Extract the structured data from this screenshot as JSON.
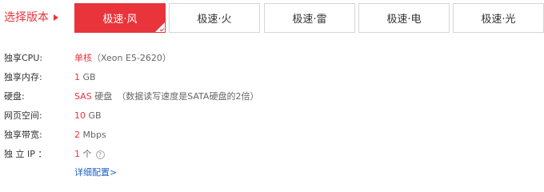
{
  "select": {
    "label": "选择版本"
  },
  "plans": [
    {
      "label": "极速·风",
      "active": true
    },
    {
      "label": "极速·火",
      "active": false
    },
    {
      "label": "极速·雷",
      "active": false
    },
    {
      "label": "极速·电",
      "active": false
    },
    {
      "label": "极速·光",
      "active": false
    }
  ],
  "specs": {
    "cpu": {
      "label": "独享CPU:",
      "value": "单核",
      "detail": "（Xeon E5-2620）"
    },
    "memory": {
      "label": "独享内存:",
      "value": "1",
      "unit": " GB"
    },
    "disk": {
      "label": "硬盘:",
      "value": "SAS",
      "unit": " 硬盘",
      "note": "（数据读写速度是SATA硬盘的2倍）"
    },
    "webspace": {
      "label": "网页空间:",
      "value": "10",
      "unit": " GB"
    },
    "bandwidth": {
      "label": "独享带宽:",
      "value": "2",
      "unit": " Mbps"
    },
    "ip": {
      "label": "独 立 IP ：",
      "value": "1",
      "unit": " 个"
    }
  },
  "detail_link": "详细配置>",
  "colors": {
    "accent": "#e8343a",
    "link": "#1f63c4",
    "border": "#d5d5d5"
  }
}
